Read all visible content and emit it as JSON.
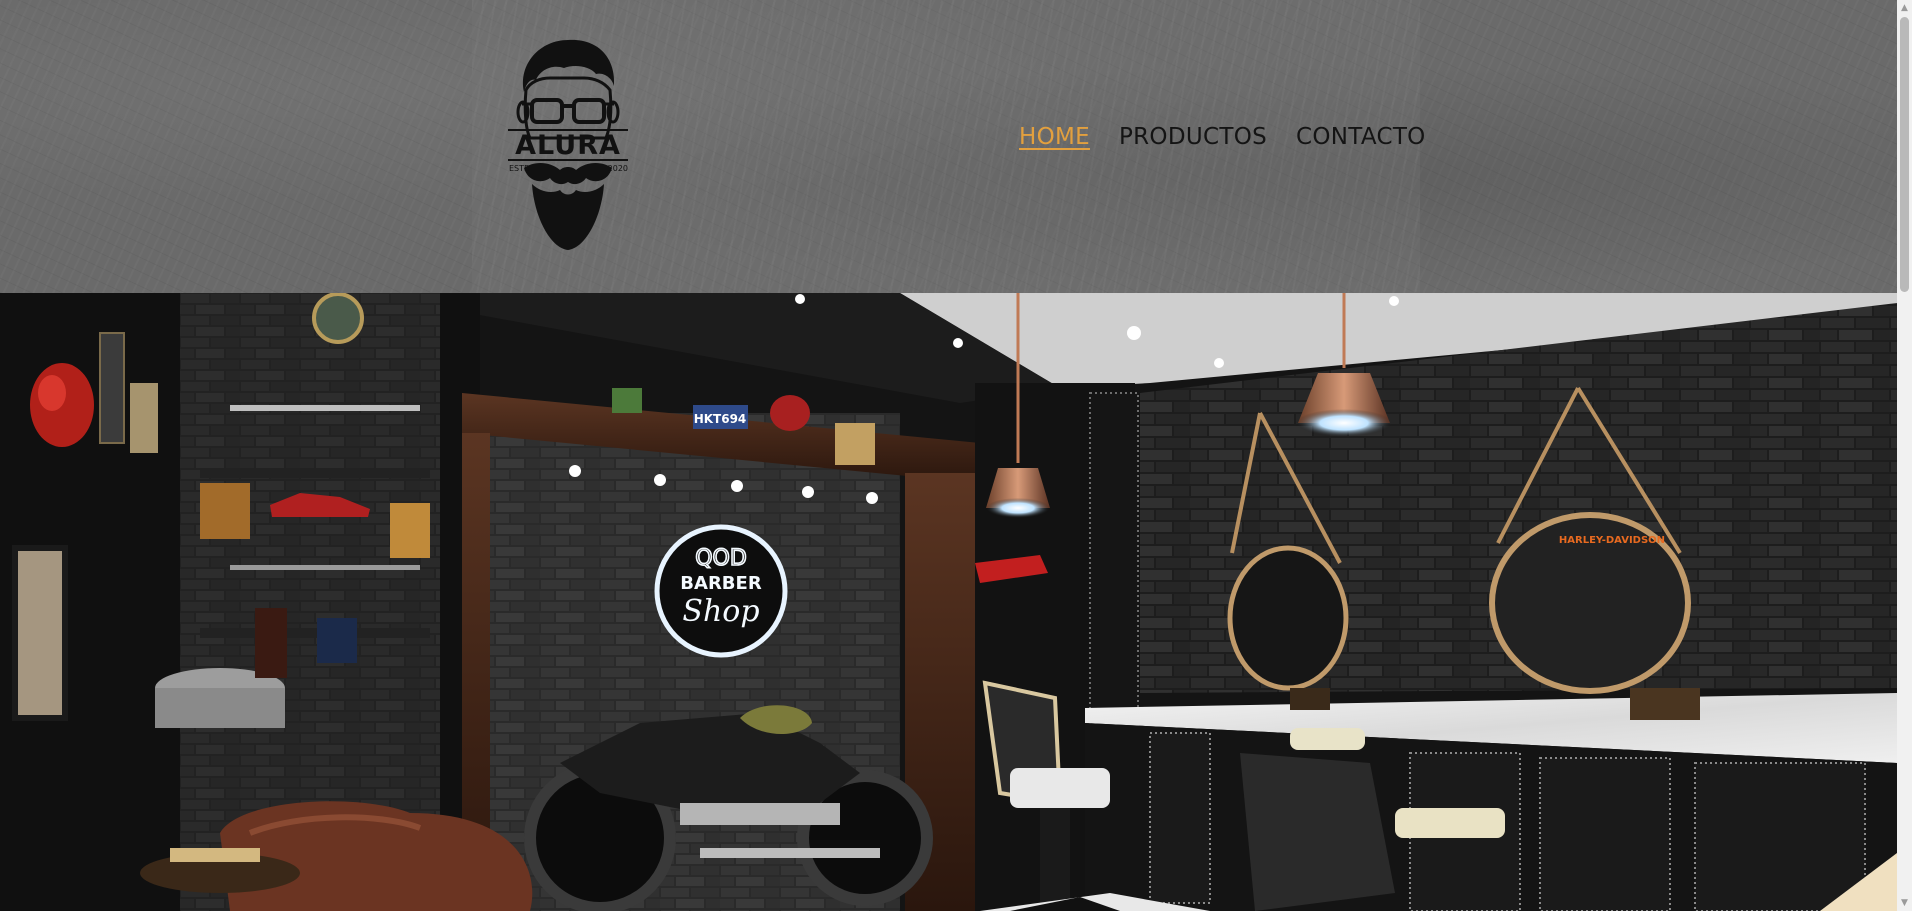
{
  "brand": {
    "logo_text": "ALURA",
    "logo_estd": "ESTD",
    "logo_year": "2020"
  },
  "nav": {
    "items": [
      {
        "label": "HOME",
        "active": true
      },
      {
        "label": "PRODUCTOS",
        "active": false
      },
      {
        "label": "CONTACTO",
        "active": false
      }
    ]
  },
  "hero": {
    "sign_line1": "QOD",
    "sign_line2": "BARBER",
    "sign_line3": "Shop",
    "plate_text": "HKT694",
    "mirror_sign": "HARLEY-DAVIDSON"
  },
  "colors": {
    "accent": "#e3a03e",
    "nav_text": "#141414",
    "header_bg": "#6a6a6a"
  }
}
